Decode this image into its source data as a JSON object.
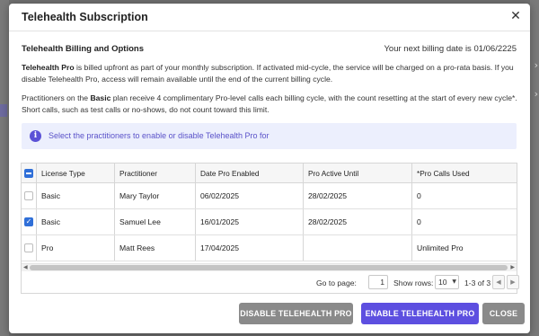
{
  "modal": {
    "title": "Telehealth Subscription",
    "close_glyph": "✕"
  },
  "section": {
    "title": "Telehealth Billing and Options",
    "billing_date": "Your next billing date is 01/06/2225"
  },
  "paragraph1": {
    "bold": "Telehealth Pro",
    "text": " is billed upfront as part of your monthly subscription. If activated mid-cycle, the service will be charged on a pro-rata basis. If you disable Telehealth Pro, access will remain available until the end of the current billing cycle."
  },
  "paragraph2": {
    "pre": "Practitioners on the ",
    "bold": "Basic",
    "post": " plan receive 4 complimentary Pro-level calls each billing cycle, with the count resetting at the start of every new cycle*. Short calls, such as test calls or no-shows, do not count toward this limit."
  },
  "info_banner": {
    "icon": "info-icon",
    "text": "Select the practitioners to enable or disable Telehealth Pro for"
  },
  "table": {
    "columns": [
      "License Type",
      "Practitioner",
      "Date Pro Enabled",
      "Pro Active Until",
      "*Pro Calls Used"
    ],
    "header_checkbox_state": "indeterminate",
    "rows": [
      {
        "checked": false,
        "license_type": "Basic",
        "practitioner": "Mary Taylor",
        "date_enabled": "06/02/2025",
        "active_until": "28/02/2025",
        "calls_used": "0"
      },
      {
        "checked": true,
        "license_type": "Basic",
        "practitioner": "Samuel Lee",
        "date_enabled": "16/01/2025",
        "active_until": "28/02/2025",
        "calls_used": "0"
      },
      {
        "checked": false,
        "license_type": "Pro",
        "practitioner": "Matt Rees",
        "date_enabled": "17/04/2025",
        "active_until": "",
        "calls_used": "Unlimited Pro"
      }
    ]
  },
  "pager": {
    "go_to_label": "Go to page:",
    "page_value": "1",
    "show_rows_label": "Show rows:",
    "rows_value": "10",
    "count_text": "1-3 of 3"
  },
  "buttons": {
    "disable": "DISABLE TELEHEALTH PRO",
    "enable": "ENABLE TELEHEALTH PRO",
    "close": "CLOSE"
  },
  "colors": {
    "accent": "#5d4fe0",
    "info_bg": "#eceffd",
    "checkbox": "#2f6fd8",
    "neutral_button": "#8a8a8a"
  }
}
